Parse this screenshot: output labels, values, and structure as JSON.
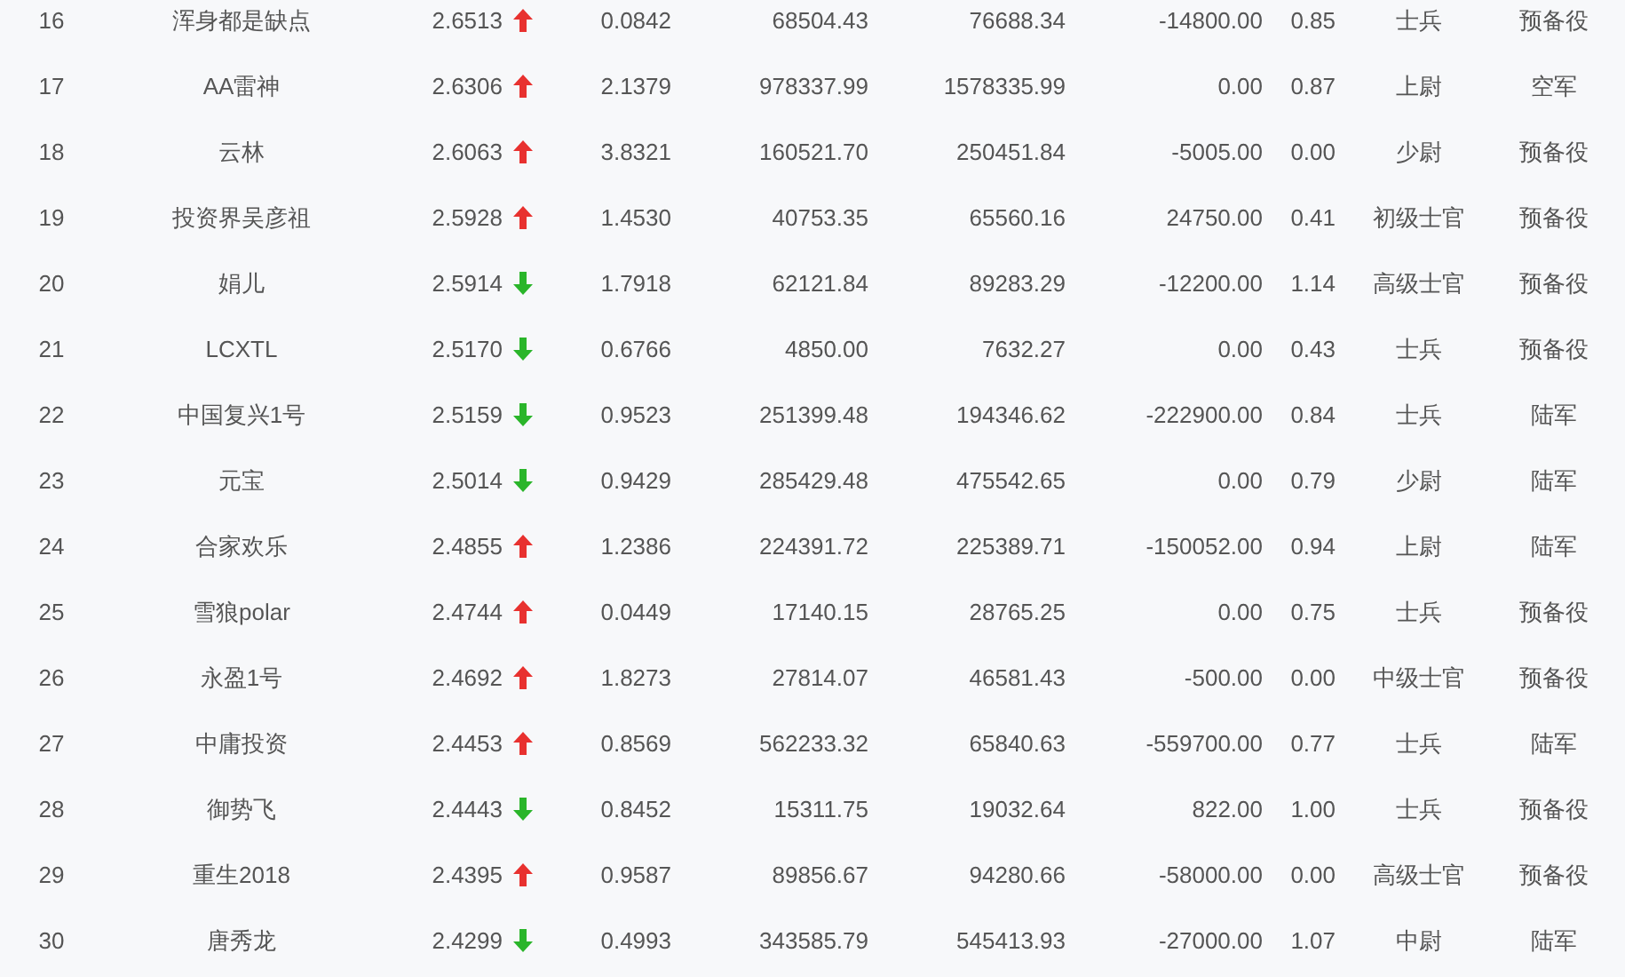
{
  "table": {
    "rows": [
      {
        "rank": "16",
        "name": "浑身都是缺点",
        "score": "2.6513",
        "rising": true,
        "column_4": "0.0842",
        "column_5": "68504.43",
        "column_6": "76688.34",
        "column_7": "-14800.00",
        "column_8": "0.85",
        "column_9": "士兵",
        "column_10": "预备役"
      },
      {
        "rank": "17",
        "name": "AA雷神",
        "score": "2.6306",
        "rising": true,
        "column_4": "2.1379",
        "column_5": "978337.99",
        "column_6": "1578335.99",
        "column_7": "0.00",
        "column_8": "0.87",
        "column_9": "上尉",
        "column_10": "空军"
      },
      {
        "rank": "18",
        "name": "云林",
        "score": "2.6063",
        "rising": true,
        "column_4": "3.8321",
        "column_5": "160521.70",
        "column_6": "250451.84",
        "column_7": "-5005.00",
        "column_8": "0.00",
        "column_9": "少尉",
        "column_10": "预备役"
      },
      {
        "rank": "19",
        "name": "投资界吴彦祖",
        "score": "2.5928",
        "rising": true,
        "column_4": "1.4530",
        "column_5": "40753.35",
        "column_6": "65560.16",
        "column_7": "24750.00",
        "column_8": "0.41",
        "column_9": "初级士官",
        "column_10": "预备役"
      },
      {
        "rank": "20",
        "name": "娟儿",
        "score": "2.5914",
        "rising": false,
        "column_4": "1.7918",
        "column_5": "62121.84",
        "column_6": "89283.29",
        "column_7": "-12200.00",
        "column_8": "1.14",
        "column_9": "高级士官",
        "column_10": "预备役"
      },
      {
        "rank": "21",
        "name": "LCXTL",
        "score": "2.5170",
        "rising": false,
        "column_4": "0.6766",
        "column_5": "4850.00",
        "column_6": "7632.27",
        "column_7": "0.00",
        "column_8": "0.43",
        "column_9": "士兵",
        "column_10": "预备役"
      },
      {
        "rank": "22",
        "name": "中国复兴1号",
        "score": "2.5159",
        "rising": false,
        "column_4": "0.9523",
        "column_5": "251399.48",
        "column_6": "194346.62",
        "column_7": "-222900.00",
        "column_8": "0.84",
        "column_9": "士兵",
        "column_10": "陆军"
      },
      {
        "rank": "23",
        "name": "元宝",
        "score": "2.5014",
        "rising": false,
        "column_4": "0.9429",
        "column_5": "285429.48",
        "column_6": "475542.65",
        "column_7": "0.00",
        "column_8": "0.79",
        "column_9": "少尉",
        "column_10": "陆军"
      },
      {
        "rank": "24",
        "name": "合家欢乐",
        "score": "2.4855",
        "rising": true,
        "column_4": "1.2386",
        "column_5": "224391.72",
        "column_6": "225389.71",
        "column_7": "-150052.00",
        "column_8": "0.94",
        "column_9": "上尉",
        "column_10": "陆军"
      },
      {
        "rank": "25",
        "name": "雪狼polar",
        "score": "2.4744",
        "rising": true,
        "column_4": "0.0449",
        "column_5": "17140.15",
        "column_6": "28765.25",
        "column_7": "0.00",
        "column_8": "0.75",
        "column_9": "士兵",
        "column_10": "预备役"
      },
      {
        "rank": "26",
        "name": "永盈1号",
        "score": "2.4692",
        "rising": true,
        "column_4": "1.8273",
        "column_5": "27814.07",
        "column_6": "46581.43",
        "column_7": "-500.00",
        "column_8": "0.00",
        "column_9": "中级士官",
        "column_10": "预备役"
      },
      {
        "rank": "27",
        "name": "中庸投资",
        "score": "2.4453",
        "rising": true,
        "column_4": "0.8569",
        "column_5": "562233.32",
        "column_6": "65840.63",
        "column_7": "-559700.00",
        "column_8": "0.77",
        "column_9": "士兵",
        "column_10": "陆军"
      },
      {
        "rank": "28",
        "name": "御势飞",
        "score": "2.4443",
        "rising": false,
        "column_4": "0.8452",
        "column_5": "15311.75",
        "column_6": "19032.64",
        "column_7": "822.00",
        "column_8": "1.00",
        "column_9": "士兵",
        "column_10": "预备役"
      },
      {
        "rank": "29",
        "name": "重生2018",
        "score": "2.4395",
        "rising": true,
        "column_4": "0.9587",
        "column_5": "89856.67",
        "column_6": "94280.66",
        "column_7": "-58000.00",
        "column_8": "0.00",
        "column_9": "高级士官",
        "column_10": "预备役"
      },
      {
        "rank": "30",
        "name": "唐秀龙",
        "score": "2.4299",
        "rising": false,
        "column_4": "0.4993",
        "column_5": "343585.79",
        "column_6": "545413.93",
        "column_7": "-27000.00",
        "column_8": "1.07",
        "column_9": "中尉",
        "column_10": "陆军"
      }
    ]
  }
}
